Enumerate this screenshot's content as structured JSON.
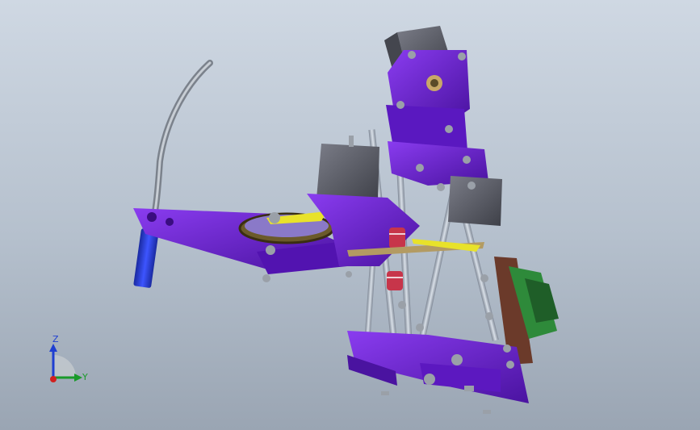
{
  "viewport": {
    "colors": {
      "background_top": "#cfd8e3",
      "background_bottom": "#9aa5b3",
      "part_purple": "#6a1fd6",
      "part_purple_dark": "#4a13a0",
      "motor_gray": "#5a5c66",
      "rod_steel": "#a9b4c2",
      "effector_blue": "#2a3fd0",
      "belt_yellow": "#e8e22a",
      "pcb_green": "#2e8a3a"
    }
  },
  "triad": {
    "z_label": "Z",
    "y_label": "Y",
    "z_color": "#1f3fd1",
    "y_color": "#1a9a2a",
    "x_color": "#d1201f"
  }
}
